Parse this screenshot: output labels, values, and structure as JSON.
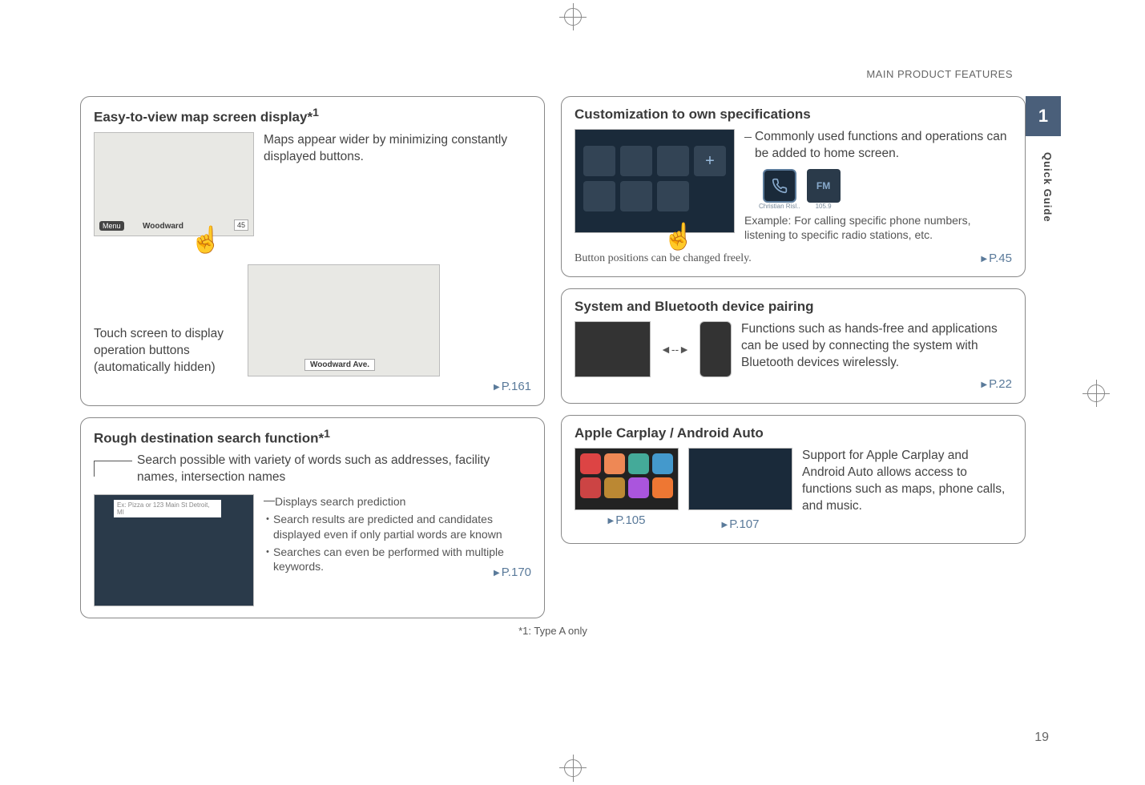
{
  "header": {
    "section_label": "MAIN PRODUCT FEATURES",
    "chapter_number": "1",
    "side_label": "Quick Guide",
    "page_number": "19"
  },
  "footnote": "*1: Type A only",
  "left": {
    "card1": {
      "title": "Easy-to-view map screen display*",
      "title_sup": "1",
      "desc1": "Maps appear wider by minimizing constantly displayed buttons.",
      "desc2": "Touch screen to display operation buttons (automatically hidden)",
      "map_label_1": "Woodward",
      "map_label_2": "Woodward Ave.",
      "speed_label": "45",
      "page_ref": "P.161"
    },
    "card2": {
      "title": "Rough destination search function*",
      "title_sup": "1",
      "desc1": "Search possible with variety of words such as addresses, facility names, intersection names",
      "sub_heading": "Displays search prediction",
      "bullet1": "Search results are predicted and candidates displayed even if only partial words are known",
      "bullet2": "Searches can even be performed with multiple keywords.",
      "search_placeholder": "Ex: Pizza or 123 Main St Detroit, MI",
      "page_ref": "P.170"
    }
  },
  "right": {
    "card1": {
      "title": "Customization to own specifications",
      "desc1": "Commonly used functions and operations can be added to home screen.",
      "example": "Example: For calling specific phone numbers, listening to specific radio stations, etc.",
      "note": "Button positions can be changed freely.",
      "tile_fm": "FM",
      "tile_fm_sub": "105.9",
      "tile_contact": "Christian Risl..",
      "page_ref": "P.45"
    },
    "card2": {
      "title": "System and Bluetooth device pairing",
      "desc1": "Functions such as hands-free and applications can be used by connecting the system with Bluetooth devices wirelessly.",
      "page_ref": "P.22"
    },
    "card3": {
      "title": "Apple Carplay / Android Auto",
      "desc1": "Support for Apple Carplay and Android Auto allows access to functions such as maps, phone calls, and music.",
      "page_ref1": "P.105",
      "page_ref2": "P.107"
    }
  }
}
